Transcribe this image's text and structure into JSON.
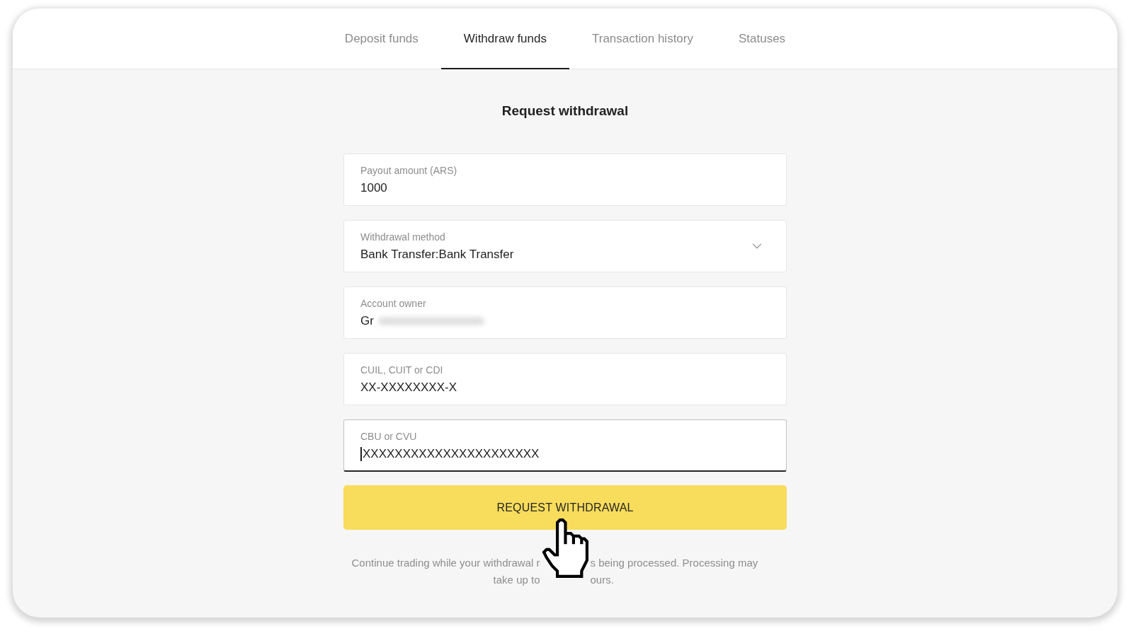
{
  "tabs": [
    {
      "label": "Deposit funds",
      "selected": false
    },
    {
      "label": "Withdraw funds",
      "selected": true
    },
    {
      "label": "Transaction history",
      "selected": false
    },
    {
      "label": "Statuses",
      "selected": false
    }
  ],
  "form": {
    "title": "Request withdrawal",
    "fields": [
      {
        "kind": "text",
        "label": "Payout amount (ARS)",
        "value": "1000",
        "focused": false
      },
      {
        "kind": "select",
        "label": "Withdrawal method",
        "value": "Bank Transfer:Bank Transfer",
        "focused": false
      },
      {
        "kind": "text",
        "label": "Account owner",
        "value": "Gr",
        "blurred_tail": true,
        "focused": false
      },
      {
        "kind": "text",
        "label": "CUIL, CUIT or CDI",
        "value": "XX-XXXXXXXX-X",
        "focused": false
      },
      {
        "kind": "text",
        "label": "CBU or CVU",
        "value": "XXXXXXXXXXXXXXXXXXXXXX",
        "focused": true
      }
    ],
    "submit_button": "REQUEST WITHDRAWAL",
    "notice_lines": [
      {
        "left": "Continue trading while your withdrawal r",
        "right": "s being processed. Processing may"
      },
      {
        "left": "take up to",
        "right": "ours."
      }
    ]
  }
}
